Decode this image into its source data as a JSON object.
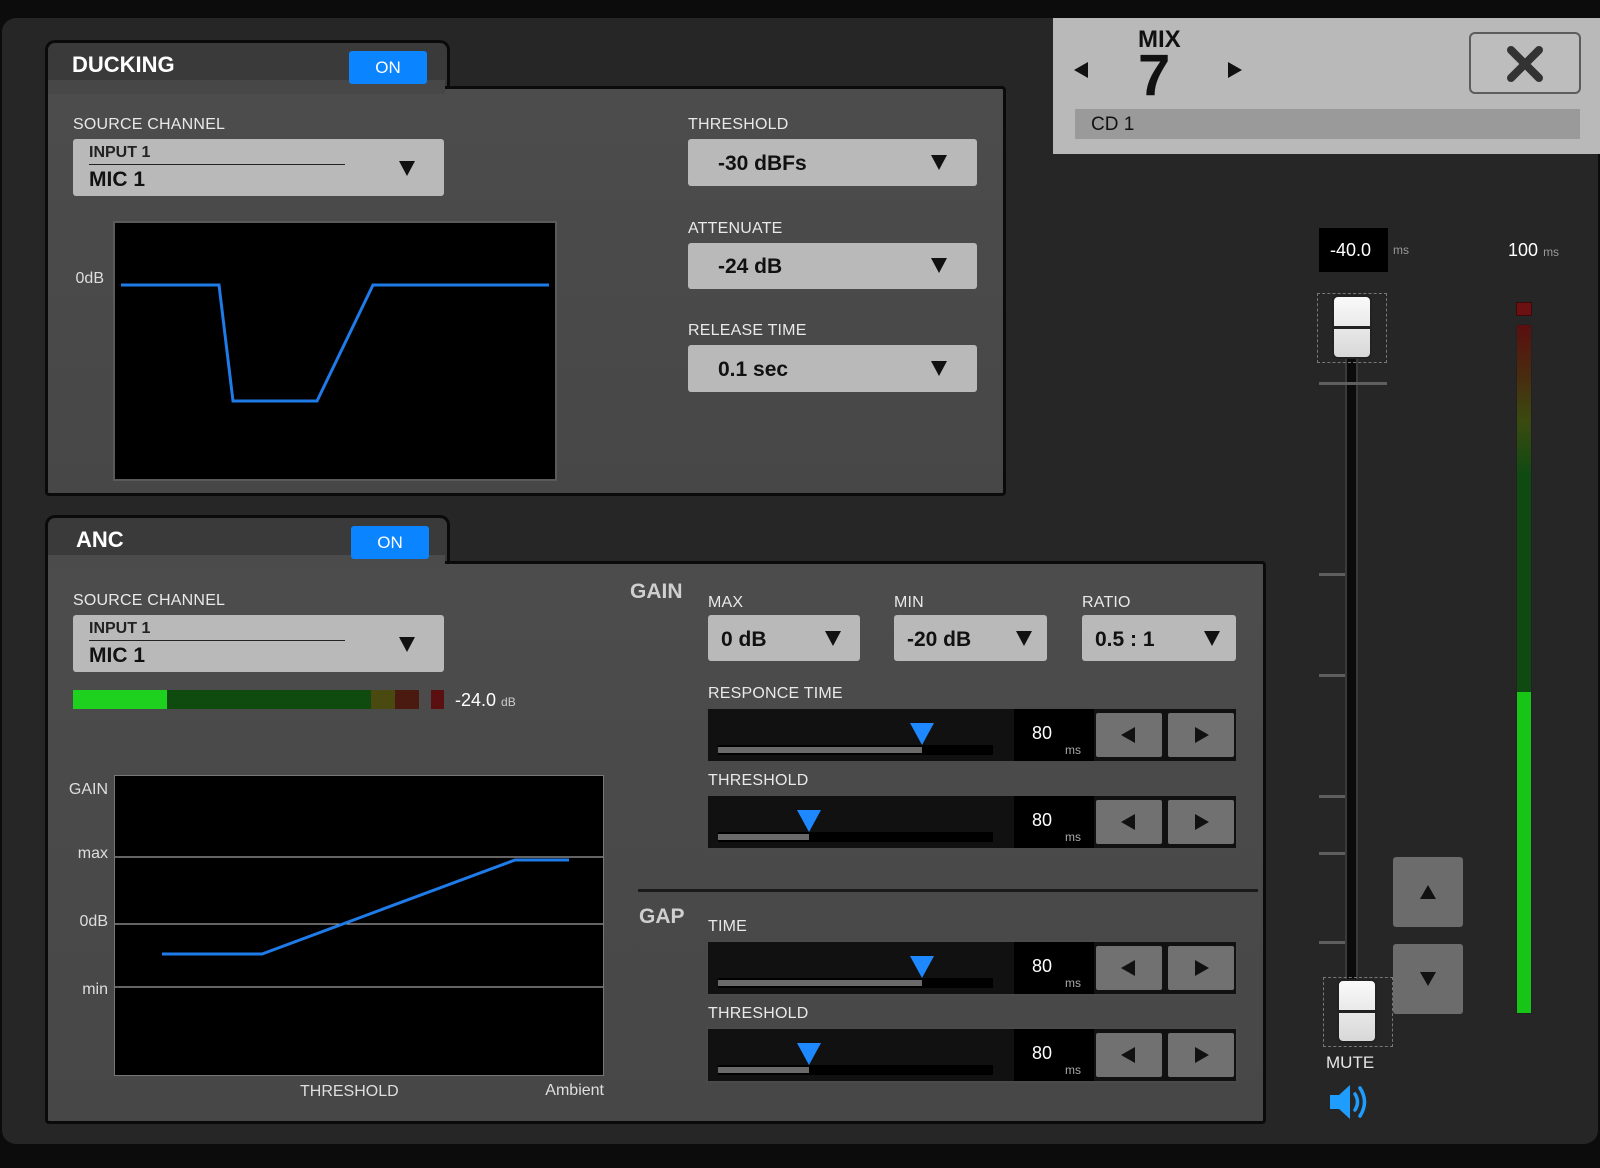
{
  "ducking": {
    "title": "DUCKING",
    "on_label": "ON",
    "source_channel_label": "SOURCE CHANNEL",
    "source_channel": {
      "input": "INPUT 1",
      "name": "MIC 1"
    },
    "graph_label": "0dB",
    "threshold_label": "THRESHOLD",
    "threshold_value": "-30 dBFs",
    "attenuate_label": "ATTENUATE",
    "attenuate_value": "-24 dB",
    "release_label": "RELEASE TIME",
    "release_value": "0.1 sec"
  },
  "anc": {
    "title": "ANC",
    "on_label": "ON",
    "source_channel_label": "SOURCE CHANNEL",
    "source_channel": {
      "input": "INPUT 1",
      "name": "MIC 1"
    },
    "meter_value": "-24.0",
    "meter_unit": "dB",
    "graph": {
      "y_labels": {
        "gain": "GAIN",
        "max": "max",
        "zero": "0dB",
        "min": "min"
      },
      "x_labels": {
        "threshold": "THRESHOLD",
        "ambient": "Ambient"
      }
    },
    "gain": {
      "heading": "GAIN",
      "max_label": "MAX",
      "max_value": "0 dB",
      "min_label": "MIN",
      "min_value": "-20 dB",
      "ratio_label": "RATIO",
      "ratio_value": "0.5 : 1",
      "response_time": {
        "label": "RESPONCE TIME",
        "value": "80",
        "unit": "ms",
        "fraction": 0.74
      },
      "threshold": {
        "label": "THRESHOLD",
        "value": "80",
        "unit": "ms",
        "fraction": 0.33
      }
    },
    "gap": {
      "heading": "GAP",
      "time": {
        "label": "TIME",
        "value": "80",
        "unit": "ms",
        "fraction": 0.74
      },
      "threshold": {
        "label": "THRESHOLD",
        "value": "80",
        "unit": "ms",
        "fraction": 0.33
      }
    }
  },
  "mix": {
    "label": "MIX",
    "number": "7",
    "channel_name": "CD 1",
    "prev_icon": "triangle-left-icon",
    "next_icon": "triangle-right-icon",
    "close_icon": "close-icon"
  },
  "fader": {
    "top_value": "-40.0",
    "top_unit": "ms",
    "meter_value": "100",
    "meter_unit": "ms",
    "mute_label": "MUTE",
    "mute_icon": "speaker-icon",
    "up_icon": "triangle-up-icon",
    "down_icon": "triangle-down-icon"
  },
  "colors": {
    "accent": "#0a84ff",
    "graph_line": "#1e7be8",
    "meter_green": "#16c516",
    "panel": "#4a4a4a"
  }
}
